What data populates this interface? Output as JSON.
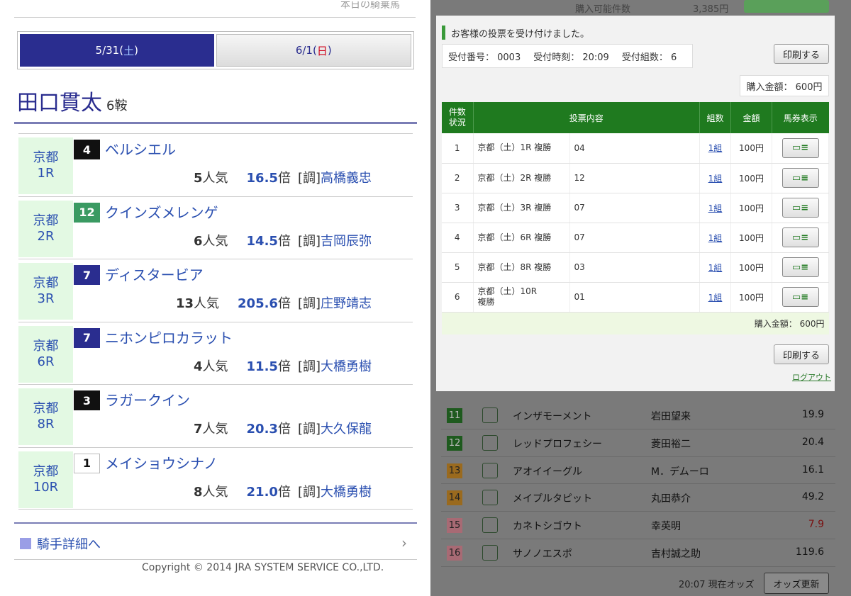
{
  "left": {
    "top_link": "本日の騎乗馬",
    "tabs": [
      {
        "date": "5/31(",
        "dow": "土",
        "close": ")"
      },
      {
        "date": "6/1(",
        "dow": "日",
        "close": ")"
      }
    ],
    "jockey": {
      "name": "田口貫太",
      "count": "6鞍"
    },
    "races": [
      {
        "place": "京都",
        "race": "1R",
        "num": "4",
        "num_style": "black",
        "horse": "ベルシエル",
        "pop": "5",
        "pop_unit": "人気",
        "odds": "16.5",
        "odds_unit": "倍",
        "tag": "[調]",
        "trainer": "高橋義忠"
      },
      {
        "place": "京都",
        "race": "2R",
        "num": "12",
        "num_style": "green",
        "horse": "クインズメレンゲ",
        "pop": "6",
        "pop_unit": "人気",
        "odds": "14.5",
        "odds_unit": "倍",
        "tag": "[調]",
        "trainer": "吉岡辰弥"
      },
      {
        "place": "京都",
        "race": "3R",
        "num": "7",
        "num_style": "blue",
        "horse": "ディスタービア",
        "pop": "13",
        "pop_unit": "人気",
        "odds": "205.6",
        "odds_unit": "倍",
        "tag": "[調]",
        "trainer": "庄野靖志"
      },
      {
        "place": "京都",
        "race": "6R",
        "num": "7",
        "num_style": "blue",
        "horse": "ニホンピロカラット",
        "pop": "4",
        "pop_unit": "人気",
        "odds": "11.5",
        "odds_unit": "倍",
        "tag": "[調]",
        "trainer": "大橋勇樹"
      },
      {
        "place": "京都",
        "race": "8R",
        "num": "3",
        "num_style": "black",
        "horse": "ラガークイン",
        "pop": "7",
        "pop_unit": "人気",
        "odds": "20.3",
        "odds_unit": "倍",
        "tag": "[調]",
        "trainer": "大久保龍"
      },
      {
        "place": "京都",
        "race": "10R",
        "num": "1",
        "num_style": "white",
        "horse": "メイショウシナノ",
        "pop": "8",
        "pop_unit": "人気",
        "odds": "21.0",
        "odds_unit": "倍",
        "tag": "[調]",
        "trainer": "大橋勇樹"
      }
    ],
    "detail_link": "騎手詳細へ",
    "chevron": "›",
    "copyright": "Copyright © 2014 JRA SYSTEM SERVICE CO.,LTD."
  },
  "right": {
    "bg_top": {
      "t1": "購入可能件数",
      "t2": "3,385円"
    },
    "notice": "お客様の投票を受け付けました。",
    "receipt": {
      "number": "受付番号： 0003",
      "time": "受付時刻： 20:09",
      "count": "受付組数： 6"
    },
    "print_label": "印刷する",
    "amount": "購入金額： 600円",
    "table_headers": [
      "件数\n状況",
      "投票内容",
      "組数",
      "金額",
      "馬券表示"
    ],
    "bets": [
      {
        "no": "1",
        "race": "京都（土）1R 複勝",
        "content": "04",
        "sets": "1組",
        "amount": "100円"
      },
      {
        "no": "2",
        "race": "京都（土）2R 複勝",
        "content": "12",
        "sets": "1組",
        "amount": "100円"
      },
      {
        "no": "3",
        "race": "京都（土）3R 複勝",
        "content": "07",
        "sets": "1組",
        "amount": "100円"
      },
      {
        "no": "4",
        "race": "京都（土）6R 複勝",
        "content": "07",
        "sets": "1組",
        "amount": "100円"
      },
      {
        "no": "5",
        "race": "京都（土）8R 複勝",
        "content": "03",
        "sets": "1組",
        "amount": "100円"
      },
      {
        "no": "6",
        "race": "京都（土）10R\n複勝",
        "content": "01",
        "sets": "1組",
        "amount": "100円"
      }
    ],
    "ticket_icon": "▭≡",
    "total": "購入金額： 600円",
    "logout": "ログアウト",
    "bg_entries": [
      {
        "num": "11",
        "color": "g",
        "horse": "インザモーメント",
        "jockey": "岩田望来",
        "odds": "19.9",
        "hot": false
      },
      {
        "num": "12",
        "color": "g",
        "horse": "レッドプロフェシー",
        "jockey": "菱田裕二",
        "odds": "20.4",
        "hot": false
      },
      {
        "num": "13",
        "color": "o",
        "horse": "アオイイーグル",
        "jockey": "M．デムーロ",
        "odds": "16.1",
        "hot": false
      },
      {
        "num": "14",
        "color": "o",
        "horse": "メイプルタピット",
        "jockey": "丸田恭介",
        "odds": "49.2",
        "hot": false
      },
      {
        "num": "15",
        "color": "p",
        "horse": "カネトシゴウト",
        "jockey": "幸英明",
        "odds": "7.9",
        "hot": true
      },
      {
        "num": "16",
        "color": "p",
        "horse": "サノノエスポ",
        "jockey": "吉村誠之助",
        "odds": "119.6",
        "hot": false
      }
    ],
    "bg_footer": "20:07 現在オッズ",
    "bg_update": "オッズ更新"
  }
}
